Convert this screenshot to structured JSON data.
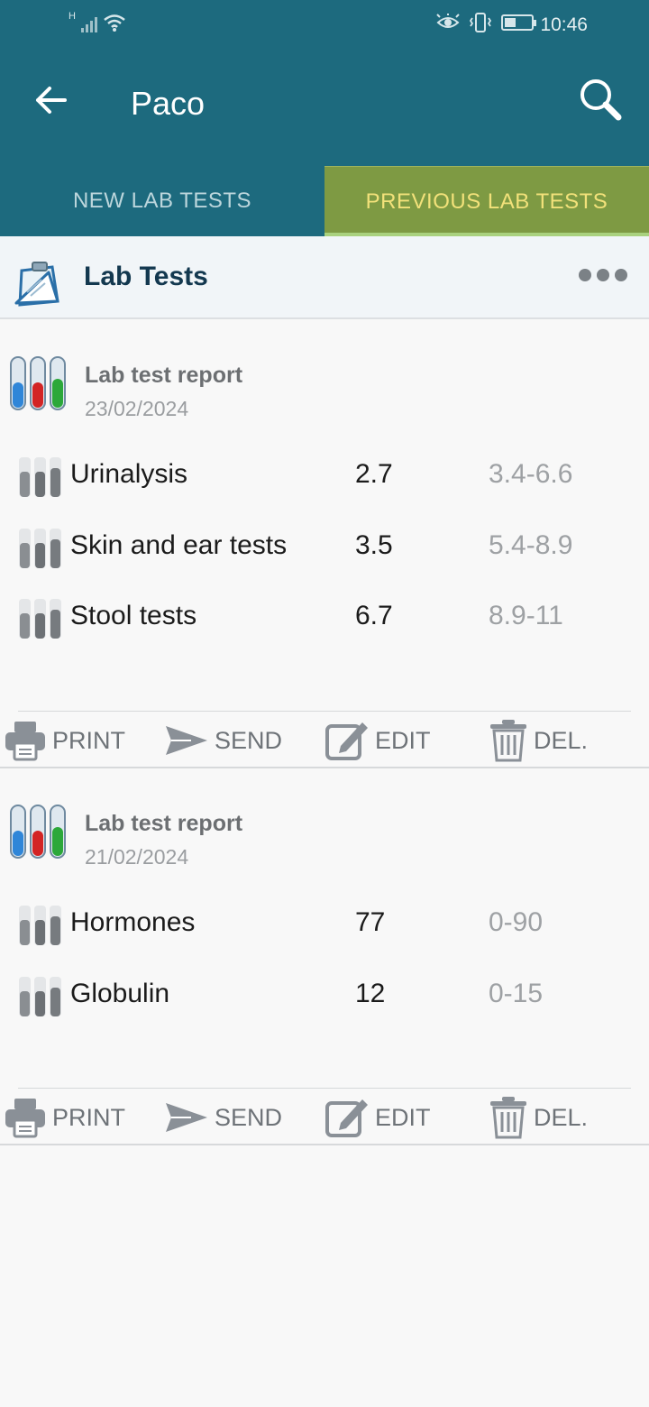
{
  "status": {
    "time": "10:46",
    "network": "H"
  },
  "appbar": {
    "title": "Paco"
  },
  "tabs": [
    {
      "label": "NEW LAB TESTS"
    },
    {
      "label": "PREVIOUS LAB TESTS"
    }
  ],
  "section": {
    "title": "Lab Tests"
  },
  "reports": [
    {
      "title": "Lab test report",
      "date": "23/02/2024",
      "tests": [
        {
          "name": "Urinalysis",
          "value": "2.7",
          "range": "3.4-6.6"
        },
        {
          "name": "Skin and ear tests",
          "value": "3.5",
          "range": "5.4-8.9"
        },
        {
          "name": "Stool tests",
          "value": "6.7",
          "range": "8.9-11"
        }
      ],
      "actions": {
        "print": "PRINT",
        "send": "SEND",
        "edit": "EDIT",
        "delete": "DEL."
      }
    },
    {
      "title": "Lab test report",
      "date": "21/02/2024",
      "tests": [
        {
          "name": "Hormones",
          "value": "77",
          "range": "0-90"
        },
        {
          "name": "Globulin",
          "value": "12",
          "range": "0-15"
        }
      ],
      "actions": {
        "print": "PRINT",
        "send": "SEND",
        "edit": "EDIT",
        "delete": "DEL."
      }
    }
  ],
  "colors": {
    "primary": "#1d6a7e",
    "tab_active_bg": "#7e9a43",
    "tab_active_text": "#f2e17a",
    "tab_inactive_text": "#bcd6dc",
    "section_title": "#13384f"
  }
}
